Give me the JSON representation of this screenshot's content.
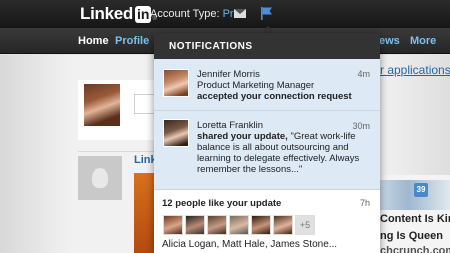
{
  "header": {
    "logo_text": "Linked",
    "logo_box": "in",
    "logo_reg": "®",
    "account_label": "Account Type:",
    "account_value": "Pro"
  },
  "nav": {
    "items": [
      "Home",
      "Profile",
      "ews",
      "More"
    ]
  },
  "page": {
    "upgrade_link": "r applications wi",
    "section_label": "Linke",
    "ad_line1": "Content Is King,",
    "ad_line2": "ng Is Queen",
    "ad_line3": "chcrunch.com",
    "ad_badge": "39"
  },
  "notifications": {
    "title": "NOTIFICATIONS",
    "items": [
      {
        "name": "Jennifer Morris",
        "headline": "Product Marketing Manager",
        "action": "accepted your connection request",
        "time": "4m"
      },
      {
        "name": "Loretta Franklin",
        "action": "shared your update,",
        "quote": " \"Great work-life balance is all about outsourcing and learning to delegate effectively. Always remember the lessons...\"",
        "time": "30m"
      },
      {
        "heading": "12 people like your update",
        "more": "+5",
        "names": "Alicia Logan, Matt Hale, James Stone...",
        "time": "7h"
      }
    ]
  },
  "colors": {
    "accent_blue": "#1f67a8",
    "unread_bg": "#dde9f5",
    "header_dark": "#333333"
  }
}
